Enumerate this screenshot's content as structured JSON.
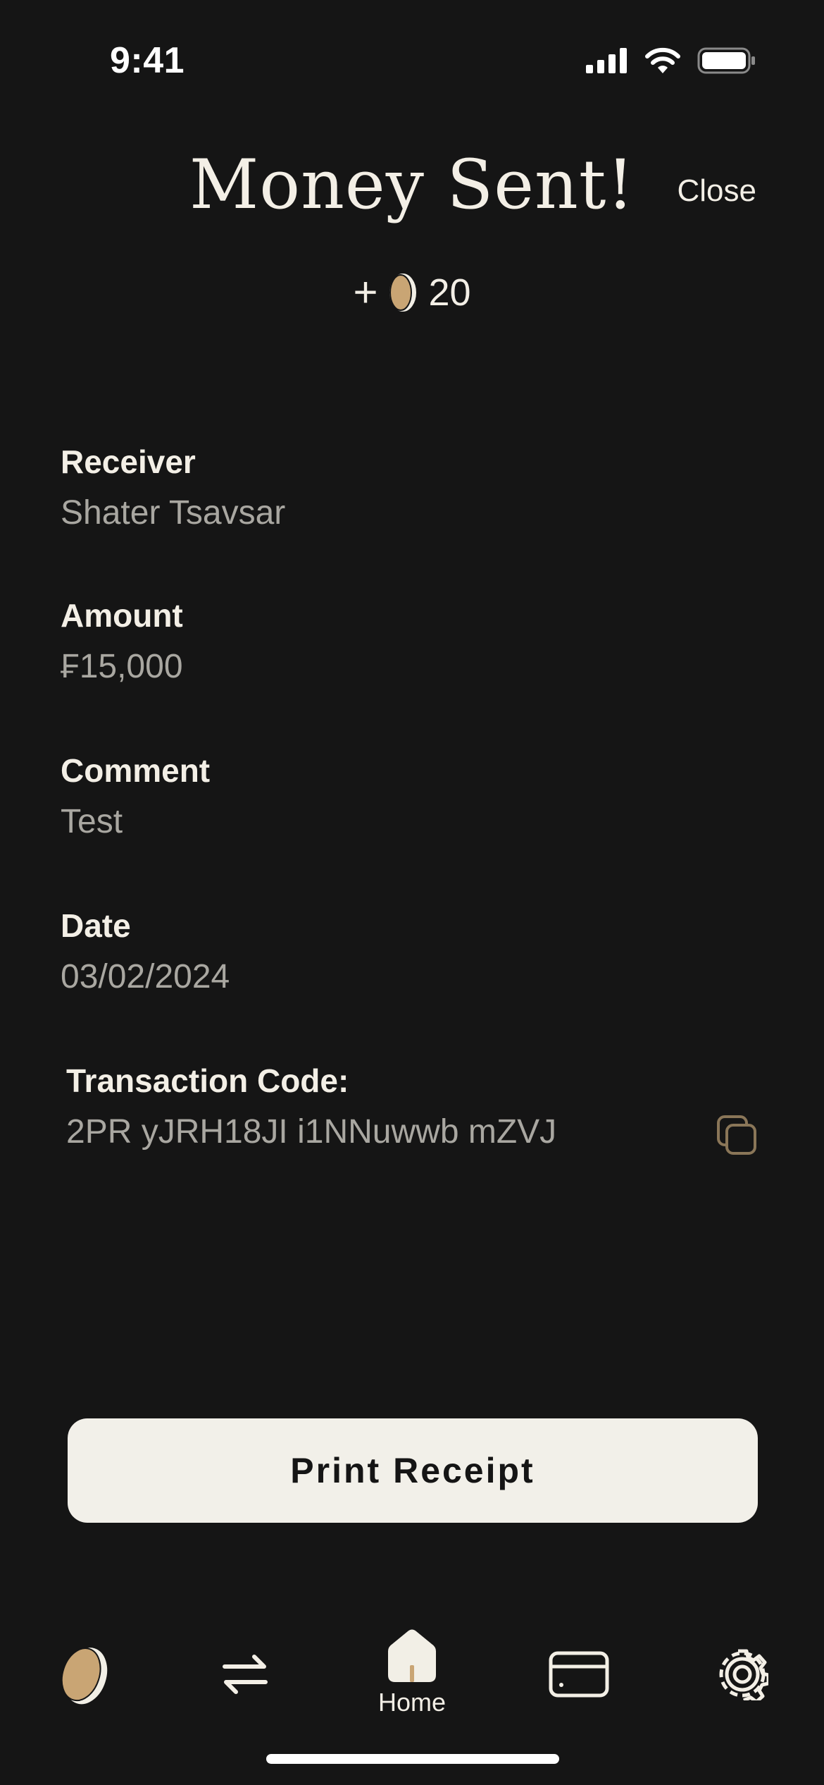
{
  "status_bar": {
    "time": "9:41"
  },
  "header": {
    "title": "Money Sent!",
    "close_label": "Close"
  },
  "reward": {
    "plus": "+",
    "amount": "20",
    "icon": "coin-icon"
  },
  "details": {
    "receiver": {
      "label": "Receiver",
      "value": "Shater Tsavsar"
    },
    "amount": {
      "label": "Amount",
      "value": "₣15,000"
    },
    "comment": {
      "label": "Comment",
      "value": "Test"
    },
    "date": {
      "label": "Date",
      "value": "03/02/2024"
    },
    "transaction_code": {
      "label": "Transaction Code:",
      "value": "2PR yJRH18JI i1NNuwwb mZVJ"
    }
  },
  "actions": {
    "print_label": "Print Receipt"
  },
  "tab_bar": {
    "tabs": [
      {
        "icon": "coin-icon",
        "label": ""
      },
      {
        "icon": "transfer-arrows-icon",
        "label": ""
      },
      {
        "icon": "home-icon",
        "label": "Home",
        "active": true
      },
      {
        "icon": "card-icon",
        "label": ""
      },
      {
        "icon": "gear-icon",
        "label": ""
      }
    ]
  },
  "colors": {
    "background": "#151515",
    "text_primary": "#f3efe6",
    "text_secondary": "#a9a7a1",
    "accent_gold": "#c9a574",
    "button_bg": "#f2f0e9"
  }
}
